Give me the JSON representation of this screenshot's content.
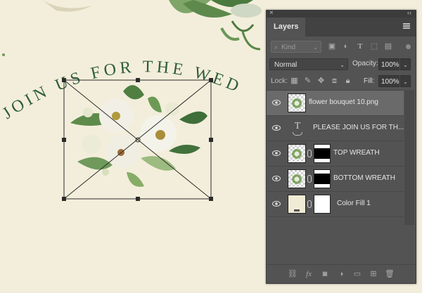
{
  "canvas": {
    "arched_text": "JOIN US FOR THE WED",
    "text_color": "#2e5e3a",
    "background_color": "#f3eedb"
  },
  "panel": {
    "tab_label": "Layers",
    "close_glyph": "×",
    "collapse_glyph": "‹‹",
    "filter": {
      "kind_label": "Kind",
      "icons": [
        "image-filter-icon",
        "adjustment-filter-icon",
        "type-filter-icon",
        "shape-filter-icon",
        "smart-object-filter-icon"
      ]
    },
    "blend_mode": "Normal",
    "opacity_label": "Opacity:",
    "opacity_value": "100%",
    "lock_label": "Lock:",
    "fill_label": "Fill:",
    "fill_value": "100%",
    "layers": [
      {
        "name": "flower bouquet 10.png",
        "type": "smart-image",
        "selected": true,
        "visible": true
      },
      {
        "name": "PLEASE JOIN US FOR TH...",
        "type": "text",
        "selected": false,
        "visible": true
      },
      {
        "name": "TOP WREATH",
        "type": "image-with-mask",
        "selected": false,
        "visible": true
      },
      {
        "name": "BOTTOM WREATH",
        "type": "image-with-mask",
        "selected": false,
        "visible": true
      },
      {
        "name": "Color Fill 1",
        "type": "fill-with-mask",
        "selected": false,
        "visible": true
      }
    ],
    "bottom_icons": [
      "link-layers-icon",
      "fx-icon",
      "add-mask-icon",
      "adjustment-layer-icon",
      "new-group-icon",
      "new-layer-icon",
      "delete-layer-icon"
    ],
    "bottom_glyphs": {
      "fx": "fx"
    }
  }
}
